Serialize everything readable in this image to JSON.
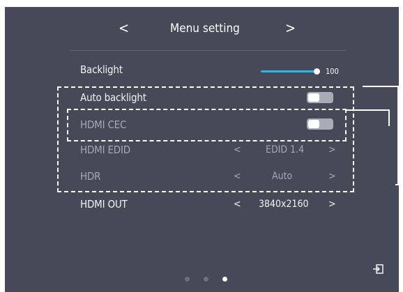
{
  "header": {
    "title": "Menu setting",
    "prev_glyph": "<",
    "next_glyph": ">"
  },
  "rows": {
    "backlight": {
      "label": "Backlight",
      "value": "100",
      "level": 1.0
    },
    "auto_backlight": {
      "label": "Auto backlight",
      "toggle_on": false
    },
    "hdmi_cec": {
      "label": "HDMI CEC",
      "toggle_on": false
    },
    "hdmi_edid": {
      "label": "HDMI EDID",
      "value": "EDID 1.4",
      "left": "<",
      "right": ">"
    },
    "hdr": {
      "label": "HDR",
      "value": "Auto",
      "left": "<",
      "right": ">"
    },
    "hdmi_out": {
      "label": "HDMI OUT",
      "value": "3840x2160",
      "left": "<",
      "right": ">"
    }
  },
  "pager": {
    "pages": 3,
    "active": 3
  },
  "icons": {
    "exit": "exit-icon",
    "prev": "chevron-left-icon",
    "next": "chevron-right-icon"
  },
  "colors": {
    "panel_bg": "#484958",
    "accent": "#21b8ec",
    "text": "#f2f2f2",
    "dim_text": "#a6a8b4"
  }
}
